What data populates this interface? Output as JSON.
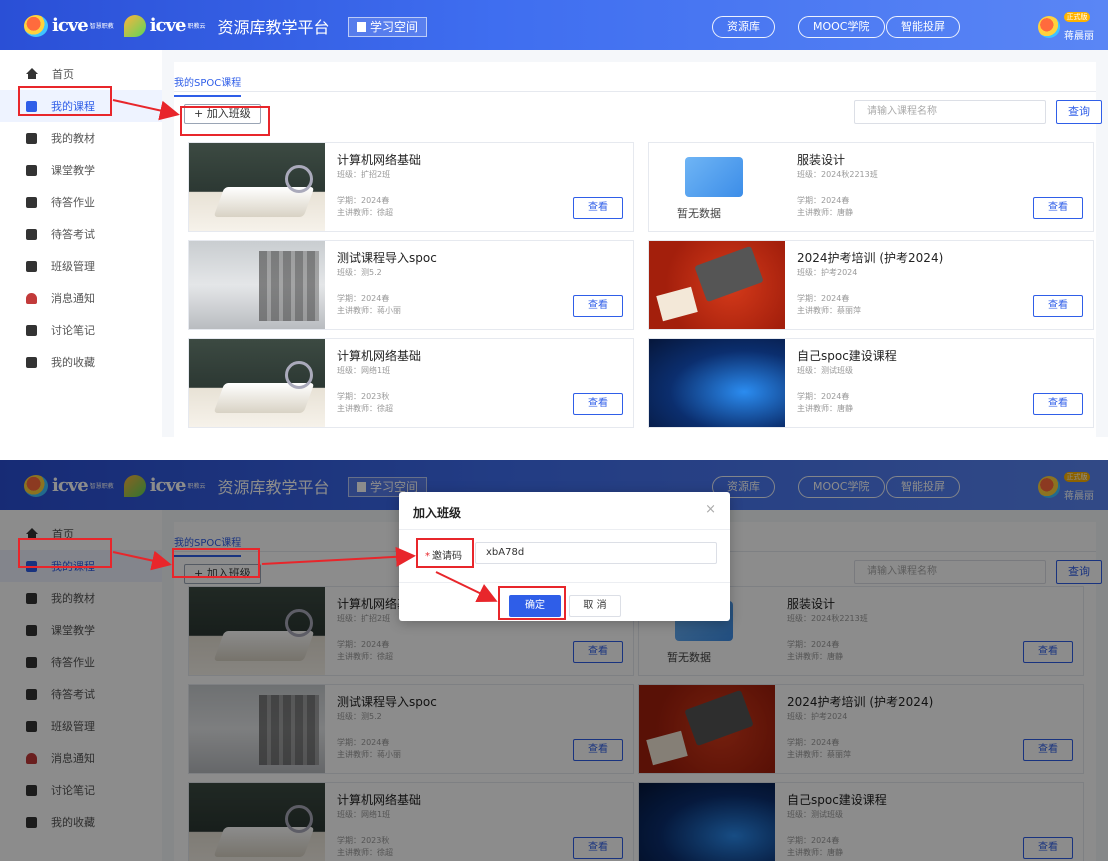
{
  "header": {
    "logo_text_1": "icve",
    "logo_sub_1": "智慧职教",
    "logo_text_2": "icve",
    "logo_sub_2": "职教云",
    "platform_title": "资源库教学平台",
    "study_space": "学习空间",
    "nav": [
      "资源库",
      "MOOC学院",
      "智能投屏"
    ],
    "user_badge": "正式版",
    "user_name": "蒋晨丽"
  },
  "sidebar": {
    "items": [
      {
        "label": "首页",
        "icon": "home-icon"
      },
      {
        "label": "我的课程",
        "icon": "books-icon"
      },
      {
        "label": "我的教材",
        "icon": "textbook-icon"
      },
      {
        "label": "课堂教学",
        "icon": "classroom-icon"
      },
      {
        "label": "待答作业",
        "icon": "homework-icon"
      },
      {
        "label": "待答考试",
        "icon": "exam-icon"
      },
      {
        "label": "班级管理",
        "icon": "class-icon"
      },
      {
        "label": "消息通知",
        "icon": "bell-icon"
      },
      {
        "label": "讨论笔记",
        "icon": "notes-icon"
      },
      {
        "label": "我的收藏",
        "icon": "folder-icon"
      }
    ],
    "active_index": 1
  },
  "main": {
    "tab": "我的SPOC课程",
    "join_button": "+ 加入班级",
    "search_placeholder": "请输入课程名称",
    "search_button": "查询",
    "view_label": "查看"
  },
  "courses": [
    {
      "title": "计算机网络基础",
      "class": "班级：扩招2班",
      "term": "学期：2024春",
      "teacher": "主讲教师：徐超",
      "thumb": "book"
    },
    {
      "title": "服装设计",
      "class": "班级：2024秋2213班",
      "term": "学期：2024春",
      "teacher": "主讲教师：唐静",
      "thumb": "empty",
      "empty_text": "暂无数据"
    },
    {
      "title": "测试课程导入spoc",
      "class": "班级：测5.2",
      "term": "学期：2024春",
      "teacher": "主讲教师：蒋小丽",
      "thumb": "city"
    },
    {
      "title": "2024护考培训 (护考2024)",
      "class": "班级：护考2024",
      "term": "学期：2024春",
      "teacher": "主讲教师：蔡丽萍",
      "thumb": "laptop"
    },
    {
      "title": "计算机网络基础",
      "class": "班级：网络1班",
      "term": "学期：2023秋",
      "teacher": "主讲教师：徐超",
      "thumb": "book"
    },
    {
      "title": "自己spoc建设课程",
      "class": "班级：测试班级",
      "term": "学期：2024春",
      "teacher": "主讲教师：唐静",
      "thumb": "tech"
    }
  ],
  "modal": {
    "title": "加入班级",
    "close": "×",
    "field_required": "*",
    "field_label": "邀请码",
    "field_value": "xbA78d",
    "ok_button": "确定",
    "cancel_button": "取 消"
  },
  "annotation_color": "#e8262b",
  "accent_color": "#2f5ee8"
}
